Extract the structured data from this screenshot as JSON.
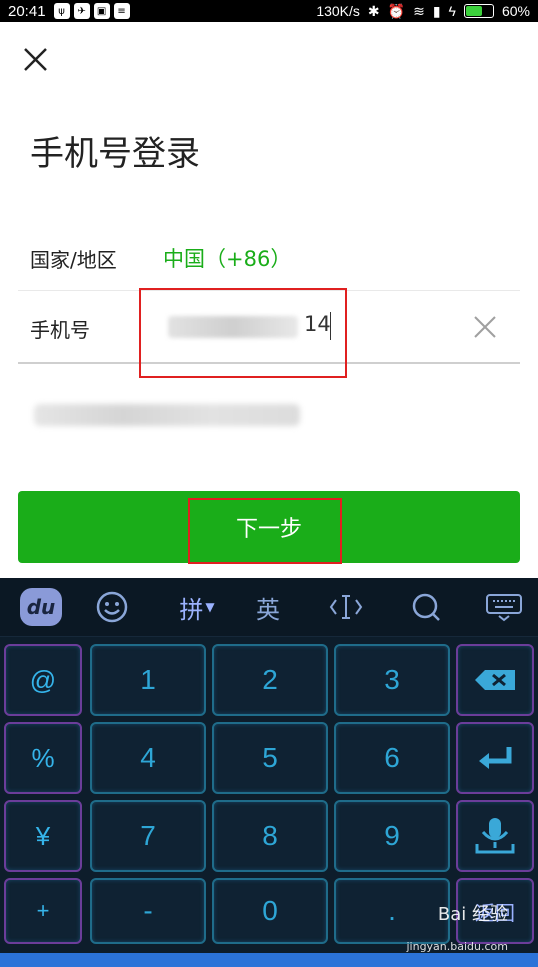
{
  "status_bar": {
    "time": "20:41",
    "network_speed": "130K/s",
    "battery": "60%",
    "battery_level": 0.6
  },
  "header": {
    "title": "手机号登录"
  },
  "form": {
    "region_label": "国家/地区",
    "region_value": "中国（+86）",
    "phone_label": "手机号",
    "phone_value_visible_suffix": "14"
  },
  "next_button": {
    "label": "下一步"
  },
  "keyboard": {
    "toolbar": {
      "logo": "du",
      "pinyin": "拼",
      "english": "英"
    },
    "rows": [
      {
        "left": "@",
        "keys": [
          "1",
          "2",
          "3"
        ],
        "right": "backspace-icon"
      },
      {
        "left": "%",
        "keys": [
          "4",
          "5",
          "6"
        ],
        "right": "enter-icon"
      },
      {
        "left": "¥",
        "keys": [
          "7",
          "8",
          "9"
        ],
        "right": "mic-icon"
      },
      {
        "left": "+",
        "keys": [
          "-",
          "0",
          "."
        ],
        "right": "返回"
      }
    ]
  },
  "watermark": {
    "text": "Bai 经验",
    "url": "jingyan.baidu.com"
  },
  "colors": {
    "accent_green": "#1aad19",
    "annotation_red": "#e02020",
    "keyboard_bg": "#0d1d2b",
    "key_text": "#2ea6d6"
  }
}
